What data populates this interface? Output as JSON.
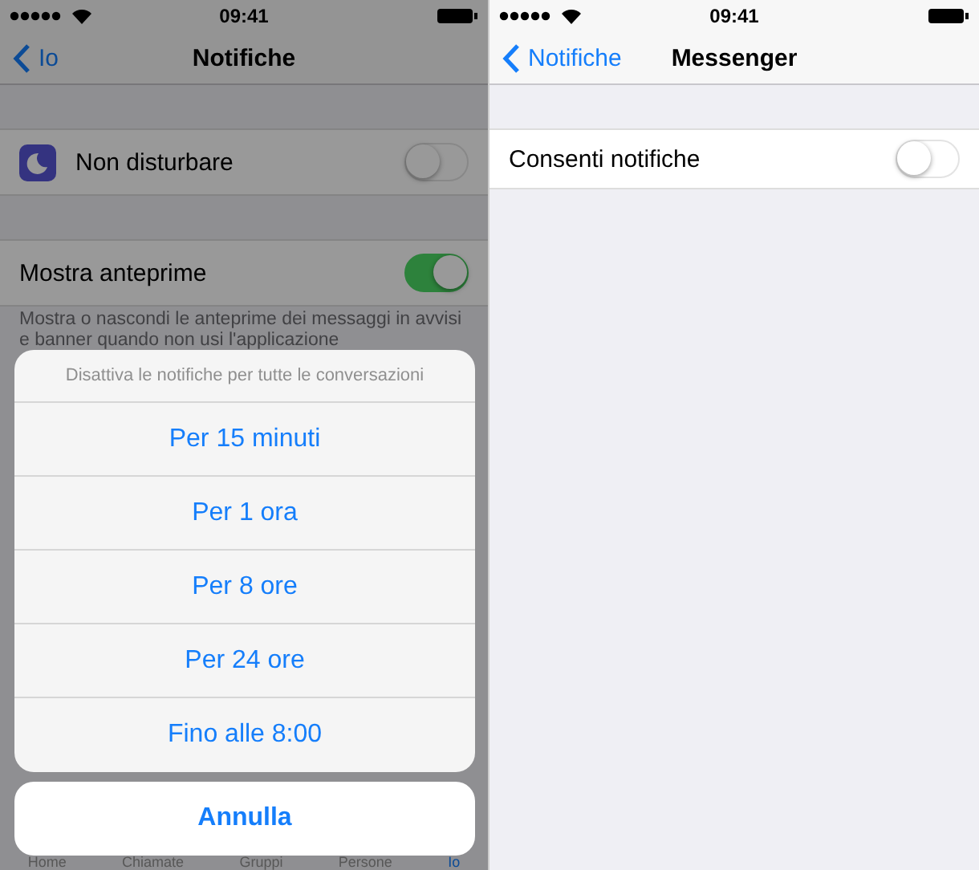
{
  "notifications_screen": {
    "status_bar": {
      "time": "09:41"
    },
    "nav_bar": {
      "back": "Io",
      "title": "Notifiche"
    },
    "do_not_disturb": {
      "label": "Non disturbare",
      "on": false
    },
    "show_previews": {
      "label": "Mostra anteprime",
      "on": true
    },
    "footer": [
      "Mostra o nascondi le anteprime dei messaggi in avvisi",
      "e banner quando non usi l'applicazione"
    ],
    "tab_bar": [
      {
        "label": "Home",
        "selected": false
      },
      {
        "label": "Chiamate",
        "selected": false
      },
      {
        "label": "Gruppi",
        "selected": false
      },
      {
        "label": "Persone",
        "selected": false
      },
      {
        "label": "Io",
        "selected": true
      }
    ],
    "action_sheet": {
      "title": "Disattiva le notifiche per tutte le conversazioni",
      "options": [
        "Per 15 minuti",
        "Per 1 ora",
        "Per 8 ore",
        "Per 24 ore",
        "Fino alle 8:00"
      ],
      "cancel": "Annulla"
    }
  },
  "messenger_screen": {
    "status_bar": {
      "time": "09:41"
    },
    "nav_bar": {
      "back": "Notifiche",
      "title": "Messenger"
    },
    "allow_notifications": {
      "label": "Consenti notifiche",
      "on": false
    }
  }
}
